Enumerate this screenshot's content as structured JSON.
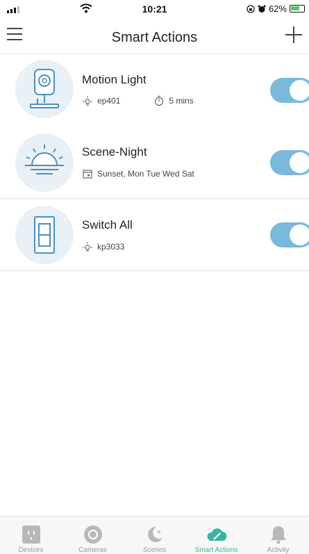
{
  "status_bar": {
    "time": "10:21",
    "battery_percent": "62%"
  },
  "nav": {
    "title": "Smart Actions",
    "menu_icon": "hamburger-menu-icon",
    "add_icon": "plus-icon"
  },
  "actions": [
    {
      "name": "Motion Light",
      "thumbnail_icon": "camera-icon",
      "device": "ep401",
      "device_icon": "bulb-icon",
      "duration": "5 mins",
      "duration_icon": "timer-icon",
      "enabled": true
    },
    {
      "name": "Scene-Night",
      "thumbnail_icon": "sunset-icon",
      "schedule": "Sunset, Mon Tue Wed Sat",
      "schedule_icon": "calendar-icon",
      "enabled": true
    },
    {
      "name": "Switch All",
      "thumbnail_icon": "wall-switch-icon",
      "device": "kp3033",
      "device_icon": "bulb-icon",
      "enabled": true
    }
  ],
  "tabs": [
    {
      "label": "Devices",
      "icon": "outlet-icon",
      "active": false
    },
    {
      "label": "Cameras",
      "icon": "camera-lens-icon",
      "active": false
    },
    {
      "label": "Scenes",
      "icon": "moon-stars-icon",
      "active": false
    },
    {
      "label": "Smart Actions",
      "icon": "cloud-wand-icon",
      "active": true
    },
    {
      "label": "Activity",
      "icon": "bell-icon",
      "active": false
    }
  ],
  "colors": {
    "toggle_on": "#78b9dc",
    "thumbnail_bg": "#e9f0f6",
    "tab_active": "#3ab5a0",
    "tab_inactive": "#999999"
  }
}
